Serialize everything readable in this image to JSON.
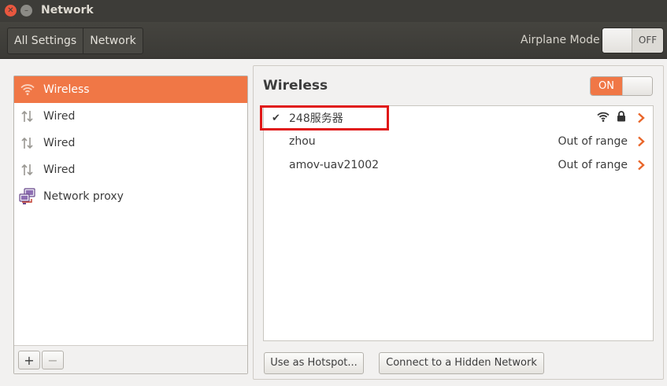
{
  "window": {
    "title": "Network"
  },
  "header": {
    "breadcrumbs": [
      "All Settings",
      "Network"
    ],
    "airplane_label": "Airplane Mode",
    "airplane_state": "OFF"
  },
  "sidebar": {
    "items": [
      {
        "label": "Wireless",
        "icon": "wifi-icon",
        "active": true
      },
      {
        "label": "Wired",
        "icon": "wired-arrows-icon",
        "active": false
      },
      {
        "label": "Wired",
        "icon": "wired-arrows-icon",
        "active": false
      },
      {
        "label": "Wired",
        "icon": "wired-arrows-icon",
        "active": false
      },
      {
        "label": "Network proxy",
        "icon": "network-proxy-icon",
        "active": false
      }
    ],
    "add_label": "+",
    "remove_label": "−"
  },
  "panel": {
    "title": "Wireless",
    "toggle_state": "ON",
    "networks": [
      {
        "name": "248服务器",
        "connected": true,
        "status": "",
        "icons": [
          "wifi-signal-icon",
          "lock-icon"
        ]
      },
      {
        "name": "zhou",
        "connected": false,
        "status": "Out of range",
        "icons": []
      },
      {
        "name": "amov-uav21002",
        "connected": false,
        "status": "Out of range",
        "icons": []
      }
    ],
    "buttons": {
      "hotspot": "Use as Hotspot...",
      "hidden": "Connect to a Hidden Network"
    }
  },
  "colors": {
    "accent": "#f07746",
    "titlebar": "#3d3c38",
    "highlight_box": "#e01818"
  }
}
